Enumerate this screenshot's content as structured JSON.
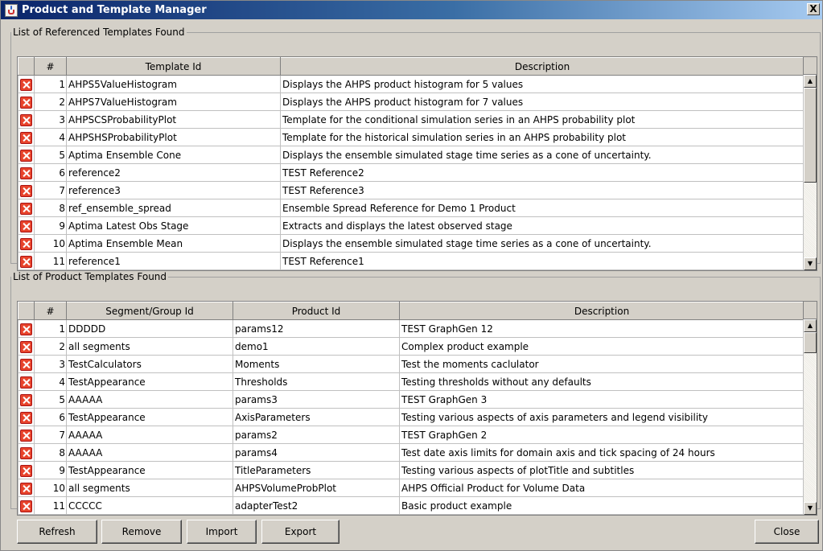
{
  "window": {
    "title": "Product and Template Manager",
    "close_glyph": "X"
  },
  "templates_group": {
    "legend": "List of Referenced Templates Found",
    "columns": [
      "#",
      "Template Id",
      "Description"
    ],
    "rows": [
      {
        "num": "1",
        "id": "AHPS5ValueHistogram",
        "desc": "Displays the AHPS product histogram for 5 values"
      },
      {
        "num": "2",
        "id": "AHPS7ValueHistogram",
        "desc": "Displays the AHPS product histogram for 7 values"
      },
      {
        "num": "3",
        "id": "AHPSCSProbabilityPlot",
        "desc": "Template for the conditional simulation series in an AHPS probability plot"
      },
      {
        "num": "4",
        "id": "AHPSHSProbabilityPlot",
        "desc": "Template for the historical simulation series in an AHPS probability plot"
      },
      {
        "num": "5",
        "id": "Aptima Ensemble Cone",
        "desc": "Displays the ensemble simulated stage time series as a cone of uncertainty."
      },
      {
        "num": "6",
        "id": "reference2",
        "desc": "TEST Reference2"
      },
      {
        "num": "7",
        "id": "reference3",
        "desc": "TEST Reference3"
      },
      {
        "num": "8",
        "id": "ref_ensemble_spread",
        "desc": "Ensemble Spread Reference for Demo 1 Product"
      },
      {
        "num": "9",
        "id": "Aptima Latest Obs Stage",
        "desc": "Extracts and displays the latest observed stage"
      },
      {
        "num": "10",
        "id": "Aptima Ensemble Mean",
        "desc": "Displays the ensemble simulated stage time series as a cone of uncertainty."
      },
      {
        "num": "11",
        "id": "reference1",
        "desc": "TEST Reference1"
      }
    ]
  },
  "products_group": {
    "legend": "List of Product Templates Found",
    "columns": [
      "#",
      "Segment/Group Id",
      "Product Id",
      "Description"
    ],
    "rows": [
      {
        "num": "1",
        "seg": "DDDDD",
        "pid": "params12",
        "desc": "TEST GraphGen 12"
      },
      {
        "num": "2",
        "seg": "all segments",
        "pid": "demo1",
        "desc": "Complex product example"
      },
      {
        "num": "3",
        "seg": "TestCalculators",
        "pid": "Moments",
        "desc": "Test the moments caclulator"
      },
      {
        "num": "4",
        "seg": "TestAppearance",
        "pid": "Thresholds",
        "desc": "Testing thresholds without any defaults"
      },
      {
        "num": "5",
        "seg": "AAAAA",
        "pid": "params3",
        "desc": "TEST GraphGen 3"
      },
      {
        "num": "6",
        "seg": "TestAppearance",
        "pid": "AxisParameters",
        "desc": "Testing various aspects of axis parameters and legend visibility"
      },
      {
        "num": "7",
        "seg": "AAAAA",
        "pid": "params2",
        "desc": "TEST GraphGen 2"
      },
      {
        "num": "8",
        "seg": "AAAAA",
        "pid": "params4",
        "desc": "Test date axis limits for domain axis and tick spacing of 24 hours"
      },
      {
        "num": "9",
        "seg": "TestAppearance",
        "pid": "TitleParameters",
        "desc": "Testing various aspects of plotTitle and subtitles"
      },
      {
        "num": "10",
        "seg": "all segments",
        "pid": "AHPSVolumeProbPlot",
        "desc": "AHPS Official Product for Volume Data"
      },
      {
        "num": "11",
        "seg": "CCCCC",
        "pid": "adapterTest2",
        "desc": "Basic product example"
      }
    ]
  },
  "buttons": {
    "refresh": "Refresh",
    "remove": "Remove",
    "import": "Import",
    "export": "Export",
    "close": "Close"
  },
  "icons": {
    "app": "java-cup-icon",
    "row_delete": "delete-x-icon",
    "scroll_up": "arrow-up-icon",
    "scroll_down": "arrow-down-icon"
  },
  "colors": {
    "titlebar_start": "#0a246a",
    "titlebar_end": "#a6caf0",
    "delete_icon": "#e8442c",
    "window_bg": "#d4d0c8"
  }
}
